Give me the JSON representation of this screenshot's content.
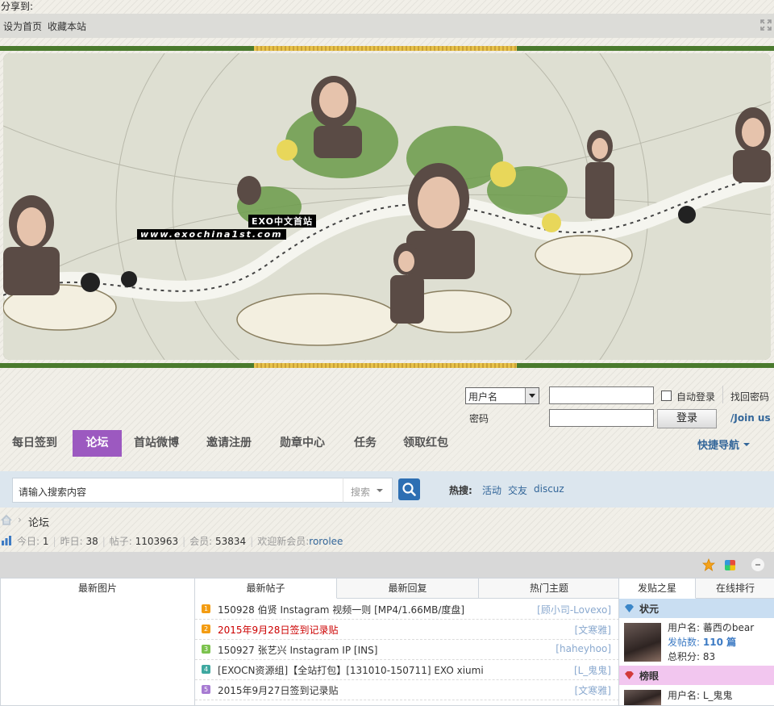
{
  "share": {
    "label": "分享到:"
  },
  "topbar": {
    "set_home": "设为首页",
    "bookmark": "收藏本站"
  },
  "banner": {
    "logo_text": "EXO中文首站",
    "url_text": "www.exochina1st.com"
  },
  "login": {
    "select_value": "用户名",
    "password_label": "密码",
    "autologin": "自动登录",
    "forgot": "找回密码",
    "login_button": "登录",
    "join": "/Join us"
  },
  "nav": {
    "items": [
      "每日签到",
      "论坛",
      "首站微博",
      "邀请注册",
      "勋章中心",
      "任务",
      "领取红包"
    ],
    "active_index": 1,
    "quick": "快捷导航"
  },
  "search": {
    "placeholder": "请输入搜索内容",
    "type": "搜索",
    "hot_label": "热搜:",
    "hot_links": [
      "活动",
      "交友",
      "discuz"
    ]
  },
  "breadcrumb": {
    "current": "论坛"
  },
  "stats": {
    "today_label": "今日:",
    "today": "1",
    "yesterday_label": "昨日:",
    "yesterday": "38",
    "posts_label": "帖子:",
    "posts": "1103963",
    "members_label": "会员:",
    "members": "53834",
    "welcome_label": "欢迎新会员:",
    "newest": "rorolee"
  },
  "portal": {
    "pics_tab": "最新图片",
    "post_tabs": [
      "最新帖子",
      "最新回复",
      "热门主题"
    ],
    "star_tabs": [
      "发贴之星",
      "在线排行"
    ],
    "colors": {
      "n1": "#f39c12",
      "n2": "#f39c12",
      "n3": "#7cc24e",
      "n4": "#3fa8a0",
      "n5": "#a77bd2",
      "red": "#cc0000"
    },
    "posts": [
      {
        "num": "1",
        "title": "150928 伯贤 Instagram 视频一则 [MP4/1.66MB/度盘]",
        "author": "[顾小司-Lovexo]",
        "red": false
      },
      {
        "num": "2",
        "title": "2015年9月28日签到记录贴",
        "author": "[文寒雅]",
        "red": true
      },
      {
        "num": "3",
        "title": "150927 张艺兴 Instagram IP [INS]",
        "author": "[haheyhoo]",
        "red": false
      },
      {
        "num": "4",
        "title": "[EXOCN资源组]【全站打包】[131010-150711] EXO xiumi",
        "author": "[L_鬼鬼]",
        "red": false
      },
      {
        "num": "5",
        "title": "2015年9月27日签到记录贴",
        "author": "[文寒雅]",
        "red": false
      }
    ],
    "stars": [
      {
        "rank": "状元",
        "name_label": "用户名:",
        "name": "蕃西のbear",
        "count_label": "发帖数:",
        "count": "110 篇",
        "score_label": "总积分:",
        "score": "83"
      },
      {
        "rank": "榜眼",
        "name_label": "用户名:",
        "name": "L_鬼鬼"
      }
    ]
  }
}
